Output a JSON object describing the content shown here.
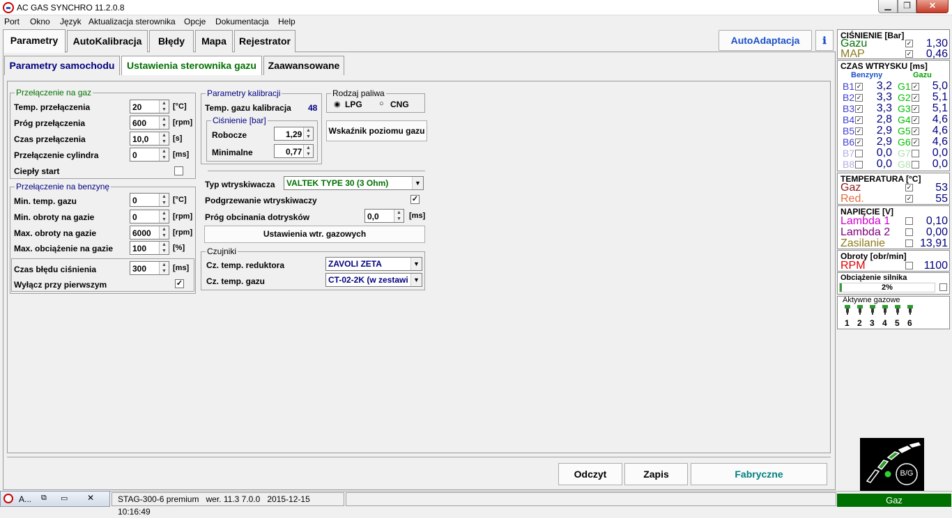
{
  "window": {
    "title": "AC GAS SYNCHRO  11.2.0.8"
  },
  "menu": [
    "Port",
    "Okno",
    "Język",
    "Aktualizacja sterownika",
    "Opcje",
    "Dokumentacja",
    "Help"
  ],
  "main_tabs": [
    "Parametry",
    "AutoKalibracja",
    "Błędy",
    "Mapa",
    "Rejestrator"
  ],
  "autoadapt_label": "AutoAdaptacja",
  "sub_tabs": [
    "Parametry samochodu",
    "Ustawienia sterownika gazu",
    "Zaawansowane"
  ],
  "switch_gas": {
    "title": "Przełączenie na gaz",
    "rows": [
      {
        "label": "Temp. przełączenia",
        "value": "20",
        "unit": "[°C]"
      },
      {
        "label": "Próg przełączenia",
        "value": "600",
        "unit": "[rpm]"
      },
      {
        "label": "Czas przełączenia",
        "value": "10,0",
        "unit": "[s]"
      },
      {
        "label": "Przełączenie cylindra",
        "value": "0",
        "unit": "[ms]"
      }
    ],
    "warm_start_label": "Ciepły start"
  },
  "switch_petrol": {
    "title": "Przełączenie na benzynę",
    "rows": [
      {
        "label": "Min. temp. gazu",
        "value": "0",
        "unit": "[°C]"
      },
      {
        "label": "Min. obroty na gazie",
        "value": "0",
        "unit": "[rpm]"
      },
      {
        "label": "Max. obroty na gazie",
        "value": "6000",
        "unit": "[rpm]"
      },
      {
        "label": "Max. obciążenie na gazie",
        "value": "100",
        "unit": "[%]"
      }
    ]
  },
  "pressure_error": {
    "label": "Czas błędu ciśnienia",
    "value": "300",
    "unit": "[ms]",
    "disable_label": "Wyłącz przy pierwszym",
    "disable_check": "✓"
  },
  "calibration": {
    "title": "Parametry kalibracji",
    "gas_temp_label": "Temp. gazu kalibracja",
    "gas_temp_value": "48",
    "pressure_title": "Ciśnienie [bar]",
    "working_label": "Robocze",
    "working_value": "1,29",
    "minimal_label": "Minimalne",
    "minimal_value": "0,77"
  },
  "fuel": {
    "title": "Rodzaj paliwa",
    "lpg": "LPG",
    "cng": "CNG",
    "gauge_button": "Wskaźnik poziomu gazu"
  },
  "injector": {
    "type_label": "Typ wtryskiwacza",
    "type_value": "VALTEK TYPE 30 (3 Ohm)",
    "heating_label": "Podgrzewanie wtryskiwaczy",
    "heating_check": "✓",
    "threshold_label": "Próg obcinania dotrysków",
    "threshold_value": "0,0",
    "threshold_unit": "[ms]",
    "settings_button": "Ustawienia wtr. gazowych"
  },
  "sensors": {
    "title": "Czujniki",
    "reducer_label": "Cz. temp. reduktora",
    "reducer_value": "ZAVOLI ZETA",
    "gas_label": "Cz. temp. gazu",
    "gas_value": "CT-02-2K (w zestawi"
  },
  "bottom_buttons": {
    "read": "Odczyt",
    "write": "Zapis",
    "factory": "Fabryczne"
  },
  "right_panel": {
    "pressure_title": "CIŚNIENIE [Bar]",
    "gazu_label": "Gazu",
    "gazu_value": "1,30",
    "map_label": "MAP",
    "map_value": "0,46",
    "inj_title": "CZAS WTRYSKU  [ms]",
    "benzyny_label": "Benzyny",
    "gazu_col_label": "Gazu",
    "injectors": [
      {
        "b": "B1",
        "bv": "3,2",
        "g": "G1",
        "gv": "5,0",
        "on": true
      },
      {
        "b": "B2",
        "bv": "3,3",
        "g": "G2",
        "gv": "5,1",
        "on": true
      },
      {
        "b": "B3",
        "bv": "3,3",
        "g": "G3",
        "gv": "5,1",
        "on": true
      },
      {
        "b": "B4",
        "bv": "2,8",
        "g": "G4",
        "gv": "4,6",
        "on": true
      },
      {
        "b": "B5",
        "bv": "2,9",
        "g": "G5",
        "gv": "4,6",
        "on": true
      },
      {
        "b": "B6",
        "bv": "2,9",
        "g": "G6",
        "gv": "4,6",
        "on": true
      },
      {
        "b": "B7",
        "bv": "0,0",
        "g": "G7",
        "gv": "0,0",
        "on": false
      },
      {
        "b": "B8",
        "bv": "0,0",
        "g": "G8",
        "gv": "0,0",
        "on": false
      }
    ],
    "temp_title": "TEMPERATURA  [°C]",
    "gaz_label": "Gaz",
    "gaz_value": "53",
    "red_label": "Red.",
    "red_value": "55",
    "volt_title": "NAPIĘCIE [V]",
    "lambda1_label": "Lambda 1",
    "lambda1_value": "0,10",
    "lambda2_label": "Lambda 2",
    "lambda2_value": "0,00",
    "supply_label": "Zasilanie",
    "supply_value": "13,91",
    "rpm_title": "Obroty [obr/min]",
    "rpm_label": "RPM",
    "rpm_value": "1100",
    "load_title": "Obciążenie silnika",
    "load_value": "2%",
    "load_fraction": 0.02,
    "active_title": "Aktywne gazowe",
    "active_nums": [
      "1",
      "2",
      "3",
      "4",
      "5",
      "6"
    ]
  },
  "logo_text": "B/G",
  "status": {
    "task_label": "A...",
    "controller": "STAG-300-6 premium",
    "version": "wer. 11.3  7.0.0",
    "datetime": "2015-12-15 10:16:49",
    "mode": "Gaz"
  },
  "colors": {
    "green": "#007000",
    "navy": "#000080",
    "olive": "#8b7a1a",
    "orange": "#e07040",
    "magenta": "#d000d0",
    "purple": "#800080",
    "gas_green": "#00c000",
    "benz_blue": "#4040d0"
  }
}
